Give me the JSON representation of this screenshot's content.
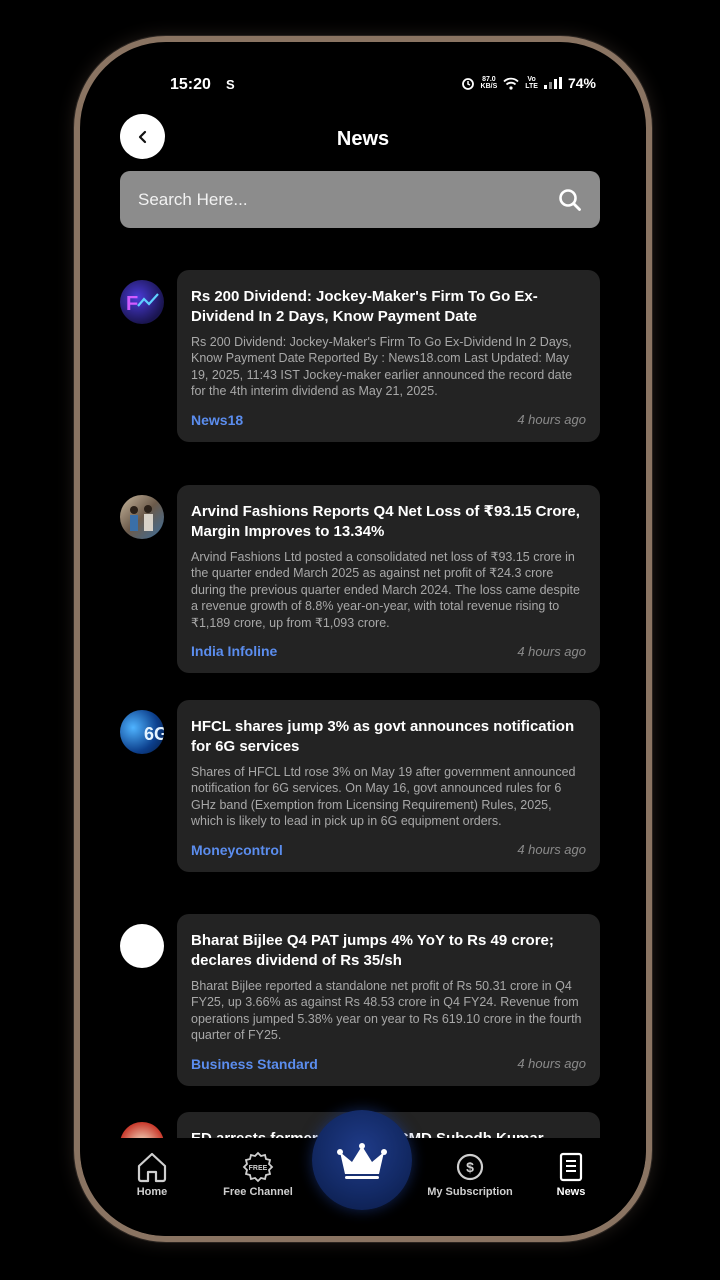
{
  "status": {
    "time": "15:20",
    "sim": "S",
    "speed_top": "87.0",
    "speed_unit": "KB/S",
    "volte_top": "Vo",
    "volte_bot": "LTE",
    "battery": "74%"
  },
  "header": {
    "title": "News"
  },
  "search": {
    "placeholder": "Search Here..."
  },
  "news": [
    {
      "title": "Rs 200 Dividend: Jockey-Maker's Firm To Go Ex-Dividend In 2 Days, Know Payment Date",
      "desc": "Rs 200 Dividend: Jockey-Maker's Firm To Go Ex-Dividend In 2 Days, Know Payment Date Reported By : News18.com Last Updated: May 19, 2025, 11:43 IST Jockey-maker earlier announced the record date for the 4th interim dividend as May 21, 2025.",
      "source": "News18",
      "ago": "4 hours ago",
      "avatar_label": "Dividend"
    },
    {
      "title": "Arvind Fashions Reports Q4 Net Loss of ₹93.15 Crore, Margin Improves to 13.34%",
      "desc": "Arvind Fashions Ltd posted a consolidated net loss of ₹93.15 crore in the quarter ended March 2025 as against net profit of ₹24.3 crore during the previous quarter ended March 2024. The loss came despite a revenue growth of 8.8% year-on-year, with total revenue rising to ₹1,189 crore, up from ₹1,093 crore.",
      "source": "India Infoline",
      "ago": "4 hours ago"
    },
    {
      "title": "HFCL shares jump 3% as govt announces notification for 6G services",
      "desc": "Shares of HFCL Ltd rose 3% on May 19 after government announced notification for 6G services. On May 16, govt announced rules for 6 GHz band (Exemption from Licensing Requirement) Rules, 2025, which is likely to lead in pick up in 6G equipment orders.",
      "source": "Moneycontrol",
      "ago": "4 hours ago",
      "avatar_label": "6G"
    },
    {
      "title": "Bharat Bijlee Q4 PAT jumps 4% YoY to Rs 49 crore; declares dividend of Rs 35/sh",
      "desc": "Bharat Bijlee reported a standalone net profit of Rs 50.31 crore in Q4 FY25, up 3.66% as against Rs 48.53 crore in Q4 FY24. Revenue from operations jumped 5.38% year on year to Rs 619.10 crore in the fourth quarter of FY25.",
      "source": "Business Standard",
      "ago": "4 hours ago"
    },
    {
      "title": "ED arrests former",
      "title_tail": "CMD Subodh Kumar"
    }
  ],
  "nav": {
    "home": "Home",
    "free": "Free Channel",
    "free_badge": "FREE",
    "subscription": "My Subscription",
    "news": "News"
  },
  "colors": {
    "accent": "#5b8dee",
    "card": "#232323",
    "crown": "#132a66"
  }
}
